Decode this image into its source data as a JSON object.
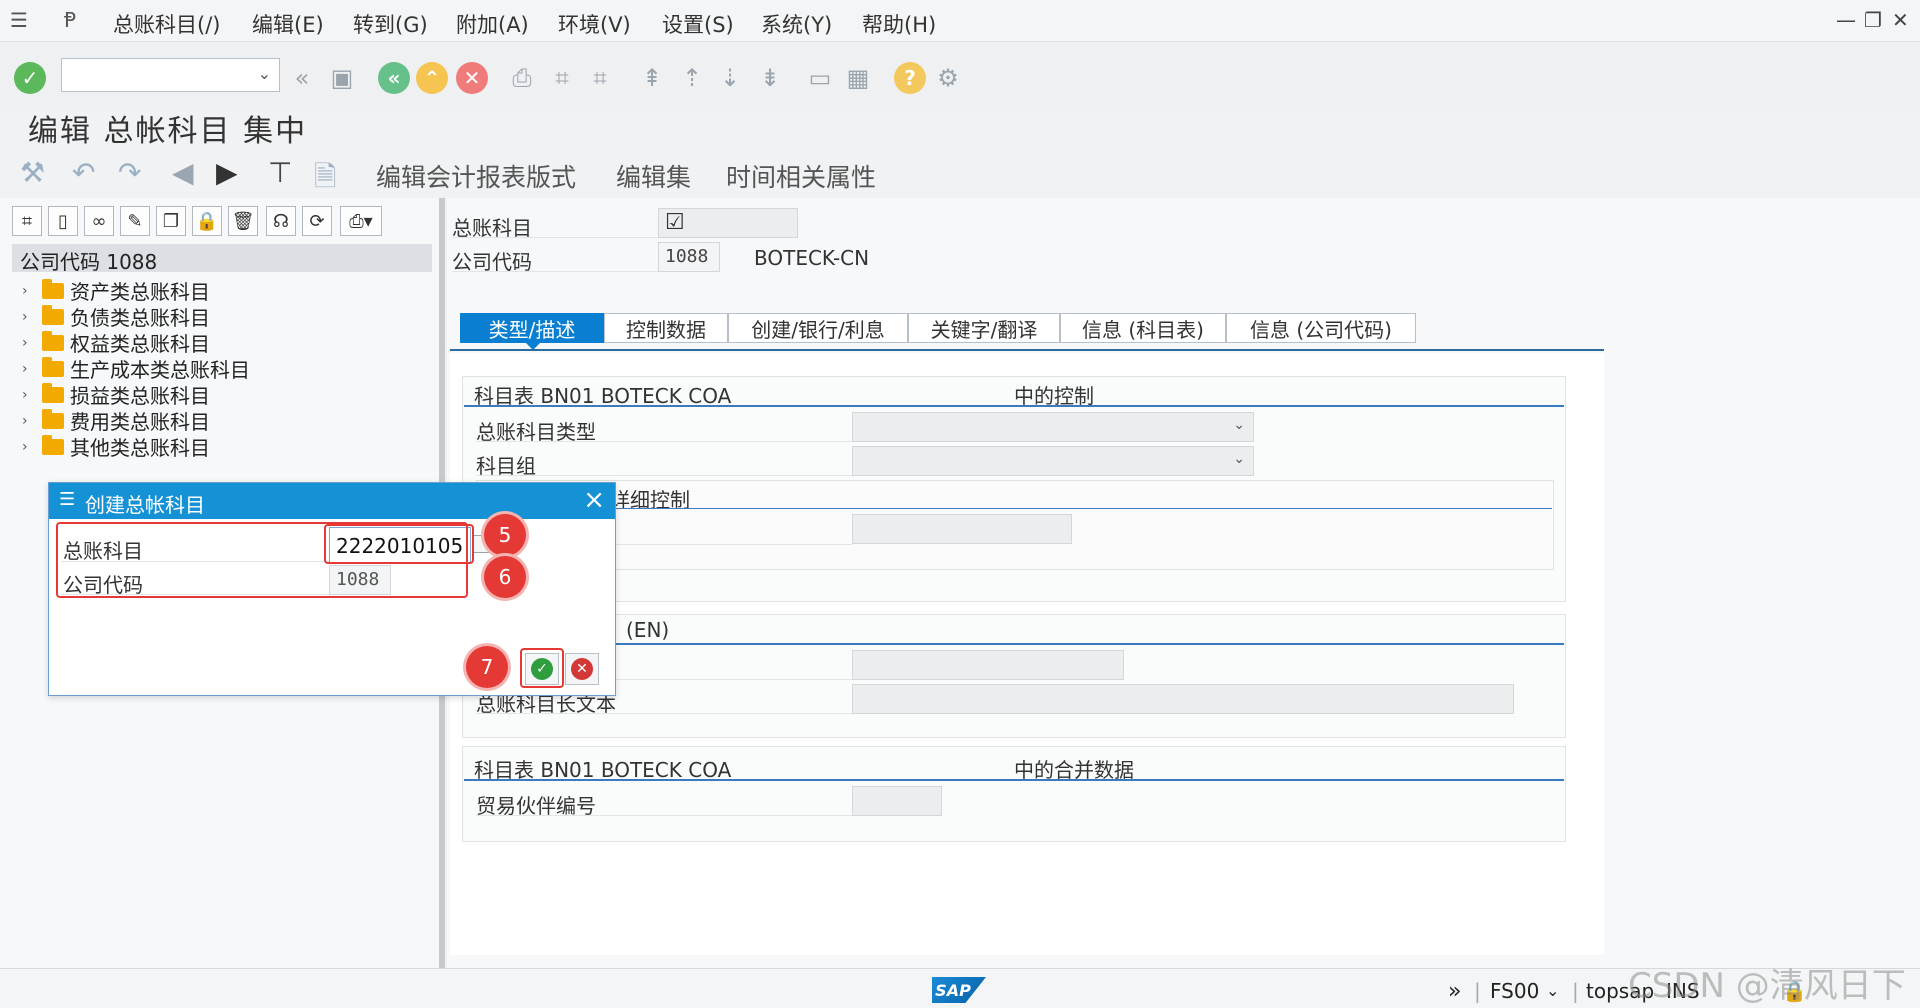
{
  "menubar": {
    "items": [
      "总账科目(/)",
      "编辑(E)",
      "转到(G)",
      "附加(A)",
      "环境(V)",
      "设置(S)",
      "系统(Y)",
      "帮助(H)"
    ]
  },
  "toolbar": {
    "command_field_value": ""
  },
  "title": "编辑 总帐科目 集中",
  "app_toolbar": {
    "items": [
      "编辑会计报表版式",
      "编辑集",
      "时间相关属性"
    ]
  },
  "tree": {
    "root_label": "公司代码 1088",
    "items": [
      "资产类总账科目",
      "负债类总账科目",
      "权益类总账科目",
      "生产成本类总账科目",
      "损益类总账科目",
      "费用类总账科目",
      "其他类总账科目"
    ]
  },
  "header_fields": {
    "gl_account_label": "总账科目",
    "company_code_label": "公司代码",
    "company_code_value": "1088",
    "company_name": "BOTECK-CN"
  },
  "tabs": [
    "类型/描述",
    "控制数据",
    "创建/银行/利息",
    "关键字/翻译",
    "信息 (科目表)",
    "信息 (公司代码)"
  ],
  "active_tab": "类型/描述",
  "group1": {
    "title": "科目表 BN01 BOTECK COA",
    "title_suffix": "中的控制",
    "row1_label": "总账科目类型",
    "row2_label": "科目组",
    "sub_title": "详细控制"
  },
  "group2": {
    "title_fragment": "(EN)",
    "long_text_label": "总账科目长文本"
  },
  "group3": {
    "title": "科目表 BN01 BOTECK COA",
    "title_suffix": "中的合并数据",
    "row1_label": "贸易伙伴编号"
  },
  "dialog": {
    "title": "创建总帐科目",
    "gl_account_label": "总账科目",
    "gl_account_value": "2222010105",
    "company_code_label": "公司代码",
    "company_code_value": "1088"
  },
  "annotations": [
    "5",
    "6",
    "7"
  ],
  "statusbar": {
    "transaction": "FS00",
    "system": "topsap",
    "mode": "INS"
  },
  "watermark": "CSDN @清风日下"
}
